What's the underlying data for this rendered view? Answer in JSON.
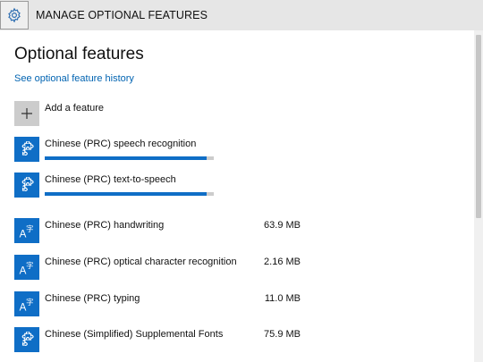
{
  "titlebar": {
    "icon": "gear-icon",
    "title": "MANAGE OPTIONAL FEATURES"
  },
  "page": {
    "title": "Optional features",
    "history_link": "See optional feature history",
    "add_feature": {
      "icon": "plus-icon",
      "label": "Add a feature"
    }
  },
  "installing": [
    {
      "name": "Chinese (PRC) speech recognition",
      "icon": "puzzle-icon",
      "progress": 0.96
    },
    {
      "name": "Chinese (PRC) text-to-speech",
      "icon": "puzzle-icon",
      "progress": 0.96
    }
  ],
  "installed": [
    {
      "name": "Chinese (PRC) handwriting",
      "icon": "language-icon",
      "size": "63.9 MB"
    },
    {
      "name": "Chinese (PRC) optical character recognition",
      "icon": "language-icon",
      "size": "2.16 MB"
    },
    {
      "name": "Chinese (PRC) typing",
      "icon": "language-icon",
      "size": "11.0 MB"
    },
    {
      "name": "Chinese (Simplified) Supplemental Fonts",
      "icon": "puzzle-icon",
      "size": "75.9 MB"
    }
  ],
  "colors": {
    "accent": "#0f6ec6",
    "link": "#0063b1",
    "titlebar": "#e6e6e6"
  }
}
